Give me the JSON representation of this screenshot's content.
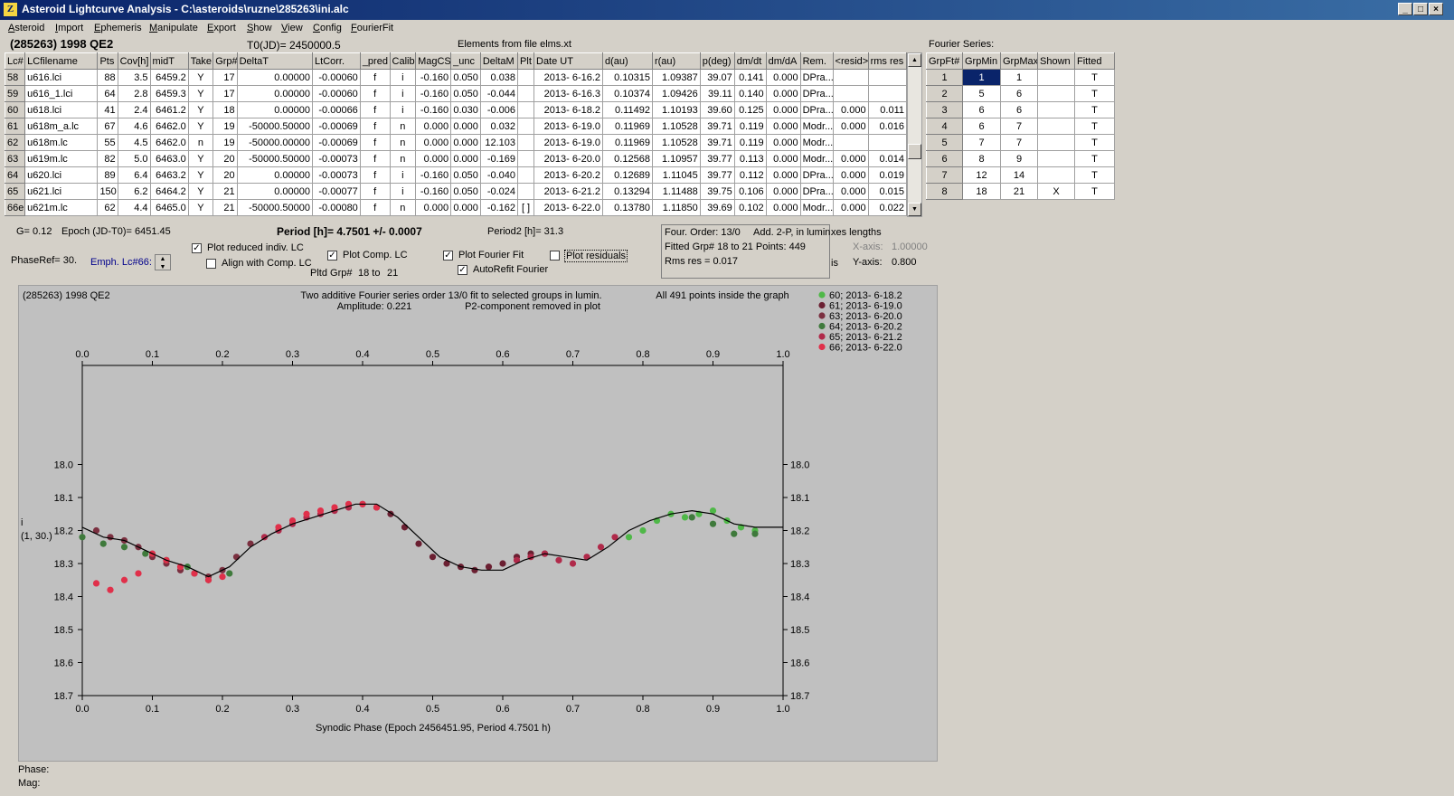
{
  "window": {
    "title": "Asteroid Lightcurve Analysis - C:\\asteroids\\ruzne\\285263\\ini.alc",
    "icon": "app-logo-icon",
    "buttons": [
      "_",
      "□",
      "×"
    ]
  },
  "menu": [
    "Asteroid",
    "Import",
    "Ephemeris",
    "Manipulate",
    "Export",
    "Show",
    "View",
    "Config",
    "FourierFit"
  ],
  "header": {
    "asteroid": "(285263) 1998 QE2",
    "t0": "T0(JD)= 2450000.5",
    "elements": "Elements from file elms.xt",
    "fourier_title": "Fourier Series:"
  },
  "lc_table": {
    "columns": [
      "Lc#",
      "LCfilename",
      "Pts",
      "Cov[h]",
      "midT",
      "Take",
      "Grp#",
      "DeltaT",
      "LtCorr.",
      "_pred",
      "Calib.",
      "MagCS",
      "_unc",
      "DeltaM",
      "Plt",
      "Date UT",
      "d(au)",
      "r(au)",
      "p(deg)",
      "dm/dt",
      "dm/dA",
      "Rem.",
      "<resid>",
      "rms res"
    ],
    "rows": [
      [
        "58",
        "u616.lci",
        "88",
        "3.5",
        "6459.2",
        "Y",
        "17",
        "0.00000",
        "-0.00060",
        "f",
        "i",
        "-0.160",
        "0.050",
        "0.038",
        "",
        "2013- 6-16.2",
        "0.10315",
        "1.09387",
        "39.07",
        "0.141",
        "0.000",
        "DPra...",
        "",
        ""
      ],
      [
        "59",
        "u616_1.lci",
        "64",
        "2.8",
        "6459.3",
        "Y",
        "17",
        "0.00000",
        "-0.00060",
        "f",
        "i",
        "-0.160",
        "0.050",
        "-0.044",
        "",
        "2013- 6-16.3",
        "0.10374",
        "1.09426",
        "39.11",
        "0.140",
        "0.000",
        "DPra...",
        "",
        ""
      ],
      [
        "60",
        "u618.lci",
        "41",
        "2.4",
        "6461.2",
        "Y",
        "18",
        "0.00000",
        "-0.00066",
        "f",
        "i",
        "-0.160",
        "0.030",
        "-0.006",
        "",
        "2013- 6-18.2",
        "0.11492",
        "1.10193",
        "39.60",
        "0.125",
        "0.000",
        "DPra...",
        "0.000",
        "0.011"
      ],
      [
        "61",
        "u618m_a.lc",
        "67",
        "4.6",
        "6462.0",
        "Y",
        "19",
        "-50000.50000",
        "-0.00069",
        "f",
        "n",
        "0.000",
        "0.000",
        "0.032",
        "",
        "2013- 6-19.0",
        "0.11969",
        "1.10528",
        "39.71",
        "0.119",
        "0.000",
        "Modr...",
        "0.000",
        "0.016"
      ],
      [
        "62",
        "u618m.lc",
        "55",
        "4.5",
        "6462.0",
        "n",
        "19",
        "-50000.00000",
        "-0.00069",
        "f",
        "n",
        "0.000",
        "0.000",
        "12.103",
        "",
        "2013- 6-19.0",
        "0.11969",
        "1.10528",
        "39.71",
        "0.119",
        "0.000",
        "Modr...",
        "",
        ""
      ],
      [
        "63",
        "u619m.lc",
        "82",
        "5.0",
        "6463.0",
        "Y",
        "20",
        "-50000.50000",
        "-0.00073",
        "f",
        "n",
        "0.000",
        "0.000",
        "-0.169",
        "",
        "2013- 6-20.0",
        "0.12568",
        "1.10957",
        "39.77",
        "0.113",
        "0.000",
        "Modr...",
        "0.000",
        "0.014"
      ],
      [
        "64",
        "u620.lci",
        "89",
        "6.4",
        "6463.2",
        "Y",
        "20",
        "0.00000",
        "-0.00073",
        "f",
        "i",
        "-0.160",
        "0.050",
        "-0.040",
        "",
        "2013- 6-20.2",
        "0.12689",
        "1.11045",
        "39.77",
        "0.112",
        "0.000",
        "DPra...",
        "0.000",
        "0.019"
      ],
      [
        "65",
        "u621.lci",
        "150",
        "6.2",
        "6464.2",
        "Y",
        "21",
        "0.00000",
        "-0.00077",
        "f",
        "i",
        "-0.160",
        "0.050",
        "-0.024",
        "",
        "2013- 6-21.2",
        "0.13294",
        "1.11488",
        "39.75",
        "0.106",
        "0.000",
        "DPra...",
        "0.000",
        "0.015"
      ],
      [
        "66e",
        "u621m.lc",
        "62",
        "4.4",
        "6465.0",
        "Y",
        "21",
        "-50000.50000",
        "-0.00080",
        "f",
        "n",
        "0.000",
        "0.000",
        "-0.162",
        "[ ]",
        "2013- 6-22.0",
        "0.13780",
        "1.11850",
        "39.69",
        "0.102",
        "0.000",
        "Modr...",
        "0.000",
        "0.022"
      ]
    ]
  },
  "fourier_table": {
    "columns": [
      "GrpFt#",
      "GrpMin",
      "GrpMax",
      "Shown",
      "Fitted"
    ],
    "rows": [
      [
        "1",
        "1",
        "1",
        "",
        "T"
      ],
      [
        "2",
        "5",
        "6",
        "",
        "T"
      ],
      [
        "3",
        "6",
        "6",
        "",
        "T"
      ],
      [
        "4",
        "6",
        "7",
        "",
        "T"
      ],
      [
        "5",
        "7",
        "7",
        "",
        "T"
      ],
      [
        "6",
        "8",
        "9",
        "",
        "T"
      ],
      [
        "7",
        "12",
        "14",
        "",
        "T"
      ],
      [
        "8",
        "18",
        "21",
        "X",
        "T"
      ]
    ]
  },
  "controls": {
    "g": "G= 0.12",
    "epoch": "Epoch (JD-T0)= 6451.45",
    "period": "Period [h]= 4.7501 +/- 0.0007",
    "period2": "Period2 [h]= 31.3",
    "phaseref": "PhaseRef= 30.",
    "emph": "Emph. Lc#66:",
    "plot_reduced": "Plot reduced indiv. LC",
    "align_comp": "Align with Comp. LC",
    "plot_comp": "Plot Comp. LC",
    "pltd_grp": "Pltd Grp#",
    "pltd_from": "18 to",
    "pltd_to": "21",
    "plot_fourier": "Plot Fourier Fit",
    "autorefit": "AutoRefit Fourier",
    "plot_residuals": "Plot residuals",
    "four_order": "Four. Order: 13/0",
    "add2p": "Add. 2-P, in lumin.",
    "fitted_grp": "Fitted Grp# 18 to 21 Points: 449",
    "rms_res": "Rms res     = 0.017",
    "axes_lengths": "xes lengths",
    "x_axis_label": "X-axis:",
    "x_axis_val": "1.00000",
    "y_axis_label": "Y-axis:",
    "y_axis_val": "0.800",
    "axis_fragment": "is",
    "phase_label": "Phase:",
    "mag_label": "Mag:",
    "checked": {
      "plot_reduced": true,
      "align_comp": false,
      "plot_comp": true,
      "plot_fourier": true,
      "autorefit": true,
      "plot_residuals": false
    }
  },
  "chart_data": {
    "type": "scatter",
    "title": "(285263) 1998 QE2",
    "subtitle_1": "Two additive Fourier series order 13/0 fit to selected groups in lumin.",
    "subtitle_2": "Amplitude: 0.221",
    "subtitle_3": "P2-component removed in plot",
    "note": "All 491 points inside the graph",
    "xlabel": "Synodic Phase (Epoch 2456451.95, Period 4.7501 h)",
    "ylabel_1": "i",
    "ylabel_2": "(1, 30.)",
    "xlim": [
      0.0,
      1.0
    ],
    "ylim": [
      17.7,
      18.7
    ],
    "y_inverted": true,
    "xticks": [
      "0.0",
      "0.1",
      "0.2",
      "0.3",
      "0.4",
      "0.5",
      "0.6",
      "0.7",
      "0.8",
      "0.9",
      "1.0"
    ],
    "yticks": [
      "18.0",
      "18.1",
      "18.2",
      "18.3",
      "18.4",
      "18.5",
      "18.6",
      "18.7"
    ],
    "fourier_curve": {
      "x": [
        0.0,
        0.03,
        0.06,
        0.09,
        0.12,
        0.15,
        0.18,
        0.21,
        0.24,
        0.27,
        0.3,
        0.33,
        0.36,
        0.39,
        0.42,
        0.45,
        0.48,
        0.51,
        0.54,
        0.57,
        0.6,
        0.63,
        0.66,
        0.69,
        0.72,
        0.75,
        0.78,
        0.81,
        0.84,
        0.87,
        0.9,
        0.93,
        0.96,
        1.0
      ],
      "y": [
        18.19,
        18.22,
        18.23,
        18.26,
        18.29,
        18.31,
        18.34,
        18.31,
        18.25,
        18.21,
        18.18,
        18.16,
        18.14,
        18.12,
        18.12,
        18.16,
        18.22,
        18.28,
        18.31,
        18.32,
        18.32,
        18.29,
        18.27,
        18.28,
        18.29,
        18.25,
        18.2,
        18.17,
        18.15,
        18.14,
        18.15,
        18.18,
        18.19,
        18.19
      ]
    },
    "series": [
      {
        "name": "60; 2013- 6-18.2",
        "color": "#4fb848",
        "x": [
          0.78,
          0.8,
          0.82,
          0.84,
          0.86,
          0.88,
          0.9,
          0.92,
          0.94,
          0.96
        ],
        "y": [
          18.22,
          18.2,
          18.17,
          18.15,
          18.16,
          18.15,
          18.14,
          18.17,
          18.19,
          18.2
        ]
      },
      {
        "name": "61; 2013- 6-19.0",
        "color": "#6b2032",
        "x": [
          0.42,
          0.44,
          0.46,
          0.48,
          0.5,
          0.52,
          0.54,
          0.56,
          0.58,
          0.6,
          0.62,
          0.64,
          0.66
        ],
        "y": [
          18.13,
          18.15,
          18.19,
          18.24,
          18.28,
          18.3,
          18.31,
          18.32,
          18.31,
          18.3,
          18.28,
          18.27,
          18.27
        ]
      },
      {
        "name": "63; 2013- 6-20.0",
        "color": "#7b3040",
        "x": [
          0.02,
          0.04,
          0.06,
          0.08,
          0.1,
          0.12,
          0.14,
          0.16,
          0.18,
          0.2,
          0.22,
          0.24
        ],
        "y": [
          18.2,
          18.22,
          18.23,
          18.25,
          18.28,
          18.3,
          18.32,
          18.33,
          18.34,
          18.32,
          18.28,
          18.24
        ]
      },
      {
        "name": "64; 2013- 6-20.2",
        "color": "#3f7a3c",
        "x": [
          0.0,
          0.03,
          0.06,
          0.09,
          0.12,
          0.15,
          0.18,
          0.21,
          0.87,
          0.9,
          0.93,
          0.96
        ],
        "y": [
          18.22,
          18.24,
          18.25,
          18.27,
          18.29,
          18.31,
          18.35,
          18.33,
          18.16,
          18.18,
          18.21,
          18.21
        ]
      },
      {
        "name": "65; 2013- 6-21.2",
        "color": "#b02a4a",
        "x": [
          0.26,
          0.28,
          0.3,
          0.32,
          0.34,
          0.36,
          0.38,
          0.4,
          0.62,
          0.64,
          0.66,
          0.68,
          0.7,
          0.72,
          0.74,
          0.76
        ],
        "y": [
          18.22,
          18.2,
          18.18,
          18.16,
          18.15,
          18.14,
          18.13,
          18.12,
          18.29,
          18.28,
          18.27,
          18.29,
          18.3,
          18.28,
          18.25,
          18.22
        ]
      },
      {
        "name": "66; 2013- 6-22.0",
        "color": "#e0304a",
        "x": [
          0.02,
          0.04,
          0.06,
          0.08,
          0.1,
          0.12,
          0.14,
          0.16,
          0.18,
          0.2,
          0.28,
          0.3,
          0.32,
          0.34,
          0.36,
          0.38,
          0.4,
          0.42
        ],
        "y": [
          18.36,
          18.38,
          18.35,
          18.33,
          18.27,
          18.29,
          18.31,
          18.33,
          18.35,
          18.34,
          18.19,
          18.17,
          18.15,
          18.14,
          18.13,
          18.12,
          18.12,
          18.13
        ]
      }
    ]
  }
}
